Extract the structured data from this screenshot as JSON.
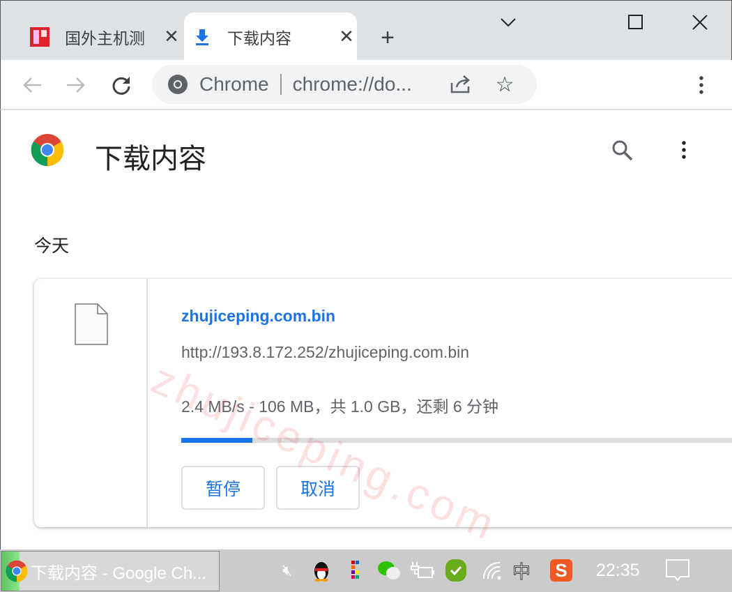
{
  "tabs": [
    {
      "title": "国外主机测",
      "favicon": "site-favicon",
      "active": false
    },
    {
      "title": "下载内容",
      "favicon": "download-icon",
      "active": true
    }
  ],
  "new_tab_icon": "plus-icon",
  "window_controls": [
    "chevron-down-icon",
    "minimize-icon",
    "maximize-icon",
    "close-icon"
  ],
  "omnibox": {
    "site_label": "Chrome",
    "url": "chrome://do..."
  },
  "page": {
    "title": "下载内容",
    "section": "今天"
  },
  "download": {
    "filename": "zhujiceping.com.bin",
    "url": "http://193.8.172.252/zhujiceping.com.bin",
    "status": "2.4 MB/s - 106 MB，共 1.0 GB，还剩 6 分钟",
    "progress_percent": 10.4,
    "pause_label": "暂停",
    "cancel_label": "取消"
  },
  "watermark": "zhujiceping.com",
  "taskbar": {
    "app_title": "下载内容 - Google Ch...",
    "clock": "22:35",
    "ime": "中"
  },
  "colors": {
    "accent": "#1a73e8",
    "tabstrip": "#dee1e6",
    "taskbar": "#cbcbcb"
  }
}
